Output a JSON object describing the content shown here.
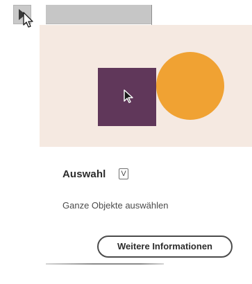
{
  "toolbar": {
    "active_tool_icon": "selection-arrow-icon",
    "cursor_icon": "mouse-pointer-icon"
  },
  "tooltip": {
    "illustration": {
      "square_color": "#60375a",
      "circle_color": "#f0a233",
      "background_color": "#f5e9e1",
      "pointer_icon": "selection-arrow-icon"
    },
    "tool_name": "Auswahl",
    "shortcut": "V",
    "description": "Ganze Objekte auswählen",
    "more_info_label": "Weitere Informationen"
  }
}
